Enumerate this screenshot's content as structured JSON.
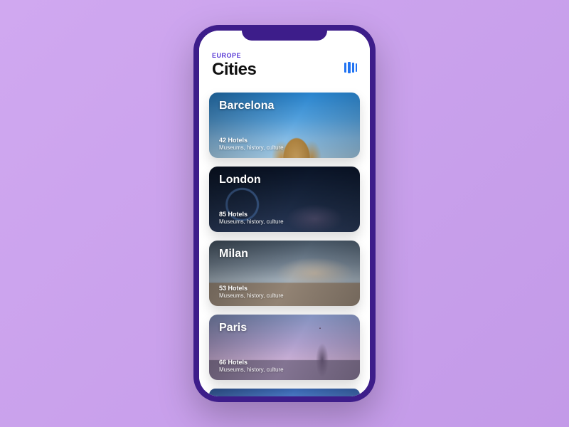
{
  "header": {
    "eyebrow": "EUROPE",
    "title": "Cities"
  },
  "cities": [
    {
      "name": "Barcelona",
      "hotels": "42 Hotels",
      "tags": "Museums, history, culture"
    },
    {
      "name": "London",
      "hotels": "85 Hotels",
      "tags": "Museums, history, culture"
    },
    {
      "name": "Milan",
      "hotels": "53 Hotels",
      "tags": "Museums, history, culture"
    },
    {
      "name": "Paris",
      "hotels": "66 Hotels",
      "tags": "Museums, history, culture"
    }
  ],
  "colors": {
    "accent": "#5a3ad6",
    "icon": "#2173f2"
  }
}
